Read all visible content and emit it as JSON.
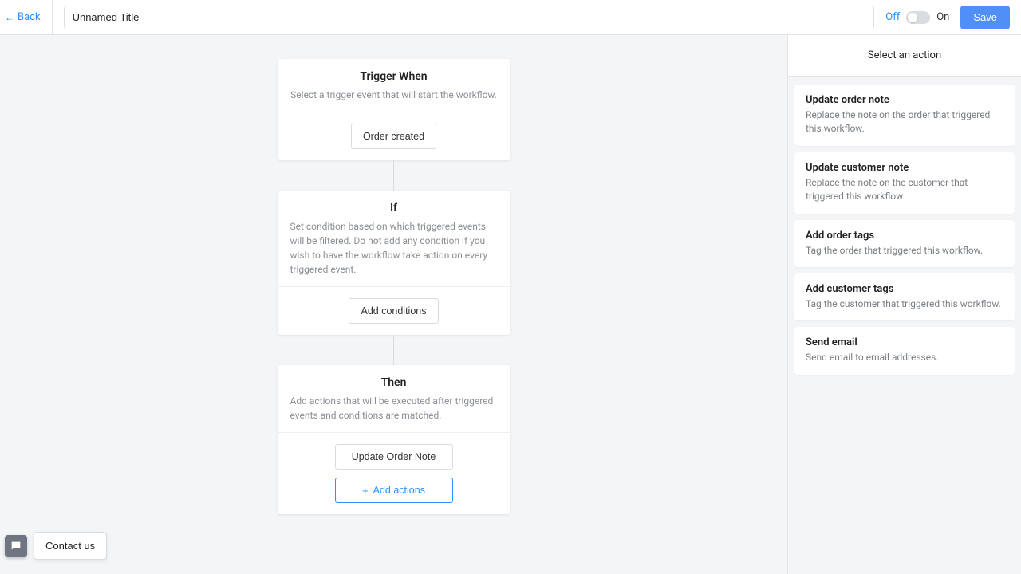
{
  "header": {
    "back_label": "Back",
    "title_value": "Unnamed Title",
    "off_label": "Off",
    "on_label": "On",
    "save_label": "Save"
  },
  "trigger": {
    "title": "Trigger When",
    "desc": "Select a trigger event that will start the workflow.",
    "button_label": "Order created"
  },
  "condition": {
    "title": "If",
    "desc": "Set condition based on which triggered events will be filtered. Do not add any condition if you wish to have the workflow take action on every triggered event.",
    "button_label": "Add conditions"
  },
  "then": {
    "title": "Then",
    "desc": "Add actions that will be executed after triggered events and conditions are matched.",
    "action_label": "Update Order Note",
    "add_label": "Add actions"
  },
  "sidebar": {
    "header": "Select an action",
    "actions": [
      {
        "title": "Update order note",
        "desc": "Replace the note on the order that triggered this workflow."
      },
      {
        "title": "Update customer note",
        "desc": "Replace the note on the customer that triggered this workflow."
      },
      {
        "title": "Add order tags",
        "desc": "Tag the order that triggered this workflow."
      },
      {
        "title": "Add customer tags",
        "desc": "Tag the customer that triggered this workflow."
      },
      {
        "title": "Send email",
        "desc": "Send email to email addresses."
      }
    ]
  },
  "contact": {
    "label": "Contact us"
  }
}
